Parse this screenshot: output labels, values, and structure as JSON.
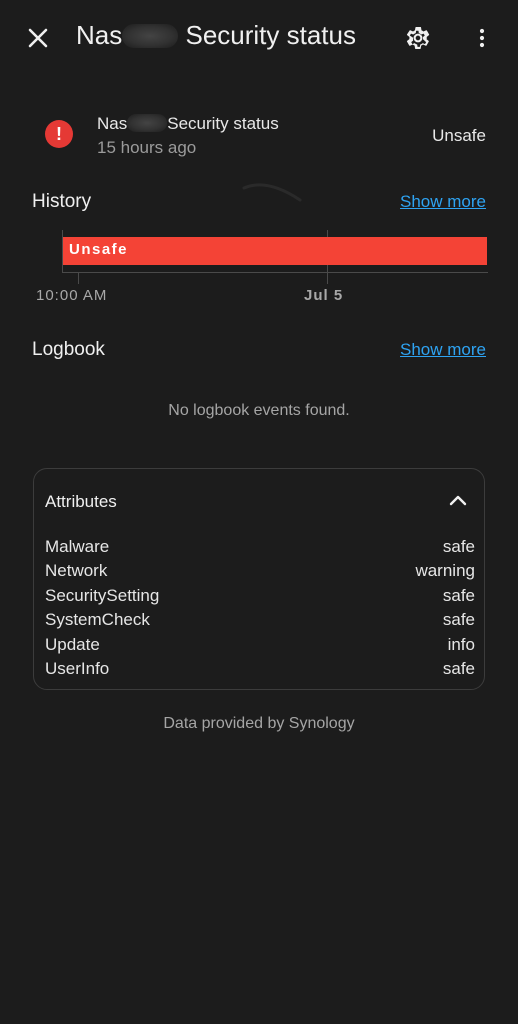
{
  "header": {
    "title_prefix": "Nas",
    "title_suffix": "Security status"
  },
  "entity": {
    "name_prefix": "Nas",
    "name_suffix": "Security status",
    "last_changed": "15 hours ago",
    "state": "Unsafe",
    "icon": "alert-circle-icon",
    "icon_color": "#e53935"
  },
  "history": {
    "title": "History",
    "show_more": "Show more",
    "tick_labels": [
      "10:00 AM",
      "Jul 5"
    ]
  },
  "chart_data": {
    "type": "timeline",
    "x": [
      "10:00 AM",
      "Jul 5"
    ],
    "series": [
      {
        "name": "",
        "segments": [
          {
            "label": "Unsafe",
            "color": "#f44336"
          }
        ]
      }
    ]
  },
  "logbook": {
    "title": "Logbook",
    "show_more": "Show more",
    "empty_text": "No logbook events found."
  },
  "attributes": {
    "title": "Attributes",
    "rows": [
      {
        "key": "Malware",
        "value": "safe"
      },
      {
        "key": "Network",
        "value": "warning"
      },
      {
        "key": "SecuritySetting",
        "value": "safe"
      },
      {
        "key": "SystemCheck",
        "value": "safe"
      },
      {
        "key": "Update",
        "value": "info"
      },
      {
        "key": "UserInfo",
        "value": "safe"
      }
    ]
  },
  "footer": {
    "attribution": "Data provided by Synology"
  },
  "colors": {
    "background": "#1c1c1c",
    "accent": "#2ea3f2",
    "unsafe": "#f44336"
  }
}
